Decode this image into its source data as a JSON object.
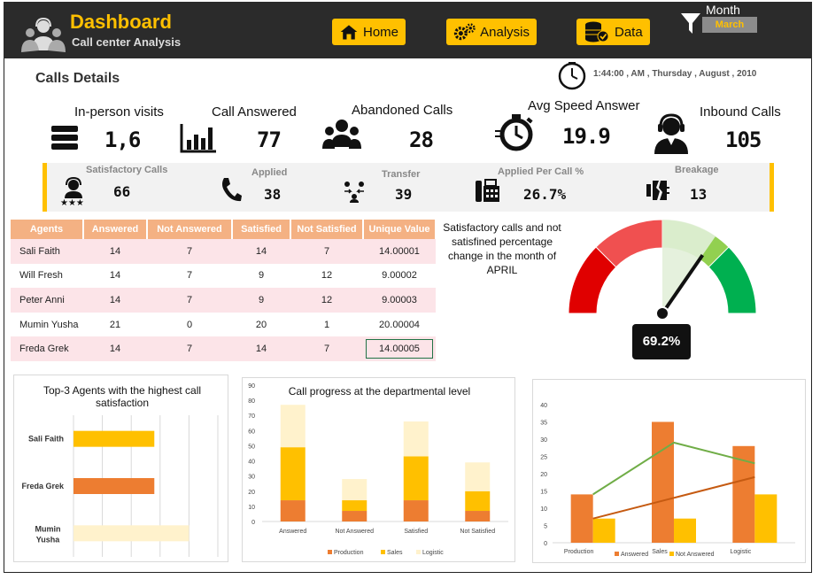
{
  "header": {
    "title": "Dashboard",
    "subtitle": "Call center Analysis",
    "nav": [
      {
        "label": "Home"
      },
      {
        "label": "Analysis"
      },
      {
        "label": "Data"
      }
    ],
    "filter": {
      "label": "Month",
      "value": "March"
    }
  },
  "section_title": "Calls Details",
  "datetime": "1:44:00 , AM , Thursday , August , 2010",
  "kpis": [
    {
      "label": "In-person visits",
      "value": "1,6",
      "icon": "server-icon"
    },
    {
      "label": "Call Answered",
      "value": "77",
      "icon": "bar-chart-icon"
    },
    {
      "label": "Abandoned Calls",
      "value": "28",
      "icon": "people-icon"
    },
    {
      "label": "Avg Speed Answer",
      "value": "19.9",
      "icon": "stopwatch-icon"
    },
    {
      "label": "Inbound Calls",
      "value": "105",
      "icon": "headset-agent-icon"
    }
  ],
  "strip": [
    {
      "label": "Satisfactory Calls",
      "value": "66",
      "icon": "rated-agent-icon"
    },
    {
      "label": "Applied",
      "value": "38",
      "icon": "phone-icon"
    },
    {
      "label": "Transfer",
      "value": "39",
      "icon": "transfer-icon"
    },
    {
      "label": "Applied Per Call %",
      "value": "26.7%",
      "icon": "fax-icon"
    },
    {
      "label": "Breakage",
      "value": "13",
      "icon": "broken-icon"
    }
  ],
  "table": {
    "headers": [
      "Agents",
      "Answered",
      "Not Answered",
      "Satisfied",
      "Not Satisfied",
      "Unique Value"
    ],
    "rows": [
      [
        "Sali Faith",
        "14",
        "7",
        "14",
        "7",
        "14.00001"
      ],
      [
        "Will Fresh",
        "14",
        "7",
        "9",
        "12",
        "9.00002"
      ],
      [
        "Peter Anni",
        "14",
        "7",
        "9",
        "12",
        "9.00003"
      ],
      [
        "Mumin Yusha",
        "21",
        "0",
        "20",
        "1",
        "20.00004"
      ],
      [
        "Freda Grek",
        "14",
        "7",
        "14",
        "7",
        "14.00005"
      ]
    ]
  },
  "gauge": {
    "note": "Satisfactory calls and not satisfined  percentage change in the month of APRIL",
    "value_label": "69.2%",
    "value": 69.2
  },
  "colors": {
    "accent": "#ffc000",
    "header_bg": "#2b2b2b",
    "orange": "#ed7d31",
    "light": "#fff2cc",
    "green": "#70ad47",
    "brown": "#c55a11",
    "red": "#e00000"
  },
  "chart_data": [
    {
      "type": "bar",
      "title": "Top-3 Agents with the highest call satisfaction",
      "categories": [
        "Sali Faith",
        "Freda Grek",
        "Mumin Yusha"
      ],
      "values": [
        14,
        14,
        20
      ],
      "bar_colors": [
        "#ffc000",
        "#ed7d31",
        "#fff2cc"
      ],
      "orientation": "horizontal",
      "xlim": [
        0,
        25
      ]
    },
    {
      "type": "bar",
      "stacked": true,
      "title": "Call progress at the departmental level",
      "categories": [
        "Answered",
        "Not Answered",
        "Satisfied",
        "Not Satisfied"
      ],
      "series": [
        {
          "name": "Production",
          "values": [
            14,
            7,
            14,
            7
          ],
          "color": "#ed7d31"
        },
        {
          "name": "Sales",
          "values": [
            35,
            7,
            29,
            13
          ],
          "color": "#ffc000"
        },
        {
          "name": "Logistic",
          "values": [
            28,
            14,
            23,
            19
          ],
          "color": "#fff2cc"
        }
      ],
      "ylim": [
        0,
        90
      ],
      "yticks": [
        0,
        10,
        20,
        30,
        40,
        50,
        60,
        70,
        80,
        90
      ],
      "legend": "bottom"
    },
    {
      "type": "bar",
      "title": "",
      "categories": [
        "Production",
        "Sales",
        "Logistic"
      ],
      "series": [
        {
          "name": "Answered",
          "values": [
            14,
            35,
            28
          ],
          "color": "#ed7d31"
        },
        {
          "name": "Not Answered",
          "values": [
            7,
            7,
            14
          ],
          "color": "#ffc000"
        }
      ],
      "lines": [
        {
          "values": [
            14,
            29,
            23
          ],
          "color": "#70ad47"
        },
        {
          "values": [
            7,
            13,
            19
          ],
          "color": "#c55a11"
        }
      ],
      "ylim": [
        0,
        40
      ],
      "yticks": [
        0,
        5,
        10,
        15,
        20,
        25,
        30,
        35,
        40
      ],
      "legend": "bottom"
    }
  ]
}
